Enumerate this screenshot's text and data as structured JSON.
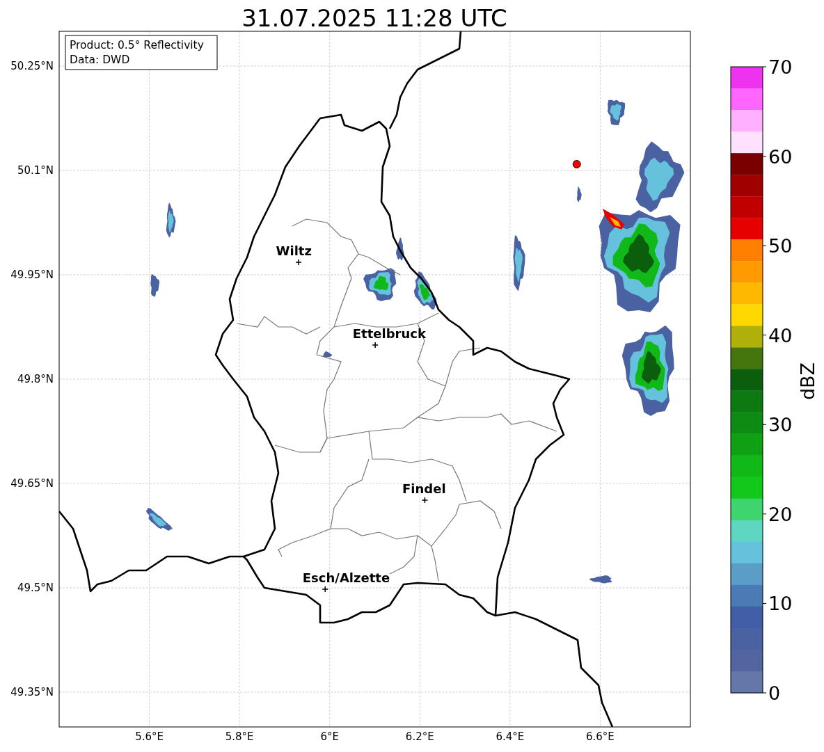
{
  "title": "31.07.2025 11:28 UTC",
  "info": [
    "Product: 0.5° Reflectivity",
    "Data: DWD"
  ],
  "map": {
    "x_ticks": [
      "5.6°E",
      "5.8°E",
      "6°E",
      "6.2°E",
      "6.4°E",
      "6.6°E"
    ],
    "y_ticks": [
      "50.25°N",
      "50.1°N",
      "49.95°N",
      "49.8°N",
      "49.65°N",
      "49.5°N",
      "49.35°N"
    ],
    "cities": [
      {
        "name": "Wiltz"
      },
      {
        "name": "Ettelbruck"
      },
      {
        "name": "Findel"
      },
      {
        "name": "Esch/Alzette"
      }
    ]
  },
  "colorbar": {
    "label": "dBZ",
    "ticks": [
      "70",
      "60",
      "50",
      "40",
      "30",
      "20",
      "10",
      "0"
    ],
    "bins": [
      {
        "color": "#ee33ee"
      },
      {
        "color": "#ff66ff"
      },
      {
        "color": "#ffb0ff"
      },
      {
        "color": "#ffe0ff"
      },
      {
        "color": "#7a0000"
      },
      {
        "color": "#a00000"
      },
      {
        "color": "#c00000"
      },
      {
        "color": "#e60000"
      },
      {
        "color": "#ff7f00"
      },
      {
        "color": "#ff9a00"
      },
      {
        "color": "#ffb800"
      },
      {
        "color": "#ffd800"
      },
      {
        "color": "#b0b00a"
      },
      {
        "color": "#45760d"
      },
      {
        "color": "#0a5e0c"
      },
      {
        "color": "#0c7a10"
      },
      {
        "color": "#0e8b12"
      },
      {
        "color": "#10a014"
      },
      {
        "color": "#10b818"
      },
      {
        "color": "#12c81b"
      },
      {
        "color": "#3fd56e"
      },
      {
        "color": "#5fd6c2"
      },
      {
        "color": "#66c2dc"
      },
      {
        "color": "#5a9ec8"
      },
      {
        "color": "#4a7bb4"
      },
      {
        "color": "#415ea6"
      },
      {
        "color": "#4a62a2"
      },
      {
        "color": "#52659f"
      },
      {
        "color": "#6577a9"
      }
    ]
  }
}
